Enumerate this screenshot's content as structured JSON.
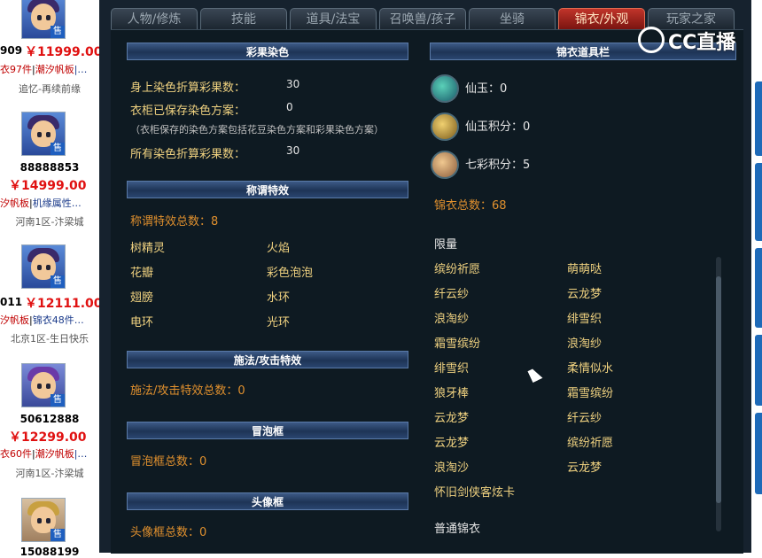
{
  "left_list": [
    {
      "id": "909",
      "price": "￥11999.00",
      "tag1": "衣97件",
      "tag2": "潮汐帆板",
      "tag_more": "…",
      "server": "追忆-再续前缘"
    },
    {
      "id": "88888853",
      "price": "￥14999.00",
      "tag1": "汐帆板",
      "tag2": "机缘属性",
      "tag_more": "…",
      "server": "河南1区-汴梁城"
    },
    {
      "id": "011",
      "price": "￥12111.00",
      "tag1": "汐帆板",
      "tag2": "锦衣48件",
      "tag_more": "…",
      "server": "北京1区-生日快乐"
    },
    {
      "id": "50612888",
      "price": "￥12299.00",
      "tag1": "衣60件",
      "tag2": "潮汐帆板",
      "tag_more": "…",
      "server": "河南1区-汴梁城"
    },
    {
      "id": "15088199",
      "price": "",
      "tag1": "",
      "tag2": "",
      "tag_more": "",
      "server": ""
    }
  ],
  "sell_badge": "售",
  "tabs": [
    "人物/修炼",
    "技能",
    "道具/法宝",
    "召唤兽/孩子",
    "坐骑",
    "锦衣/外观",
    "玩家之家"
  ],
  "active_tab": "锦衣/外观",
  "logo": {
    "text": "CC直播"
  },
  "sections": {
    "dye": {
      "title": "彩果染色",
      "rows": [
        {
          "label": "身上染色折算彩果数：",
          "value": "30"
        },
        {
          "label": "衣柜已保存染色方案：",
          "value": "0"
        }
      ],
      "note": "（衣柜保存的染色方案包括花豆染色方案和彩果染色方案）",
      "total_label": "所有染色折算彩果数：",
      "total_value": "30"
    },
    "title_fx": {
      "title": "称谓特效",
      "count": "称谓特效总数：8",
      "items": [
        "树精灵",
        "火焰",
        "花瓣",
        "彩色泡泡",
        "翅膀",
        "水环",
        "电环",
        "光环"
      ]
    },
    "cast_fx": {
      "title": "施法/攻击特效",
      "count": "施法/攻击特效总数：0"
    },
    "bubble": {
      "title": "冒泡框",
      "count": "冒泡框总数：0"
    },
    "avatar_frame": {
      "title": "头像框",
      "count": "头像框总数：0"
    },
    "jinyi_bar": {
      "title": "锦衣道具栏",
      "props": [
        {
          "label": "仙玉：0",
          "icon": "jade-icon",
          "color": "#2f9a8a"
        },
        {
          "label": "仙玉积分：0",
          "icon": "jade-points-icon",
          "color": "#d4b04a"
        },
        {
          "label": "七彩积分：5",
          "icon": "rainbow-points-icon",
          "color": "#c9a070"
        }
      ],
      "total": "锦衣总数：68",
      "limited_title": "限量",
      "limited_items": [
        "缤纷祈愿",
        "萌萌哒",
        "纤云纱",
        "云龙梦",
        "浪淘纱",
        "绯雪织",
        "霜雪缤纷",
        "浪淘纱",
        "绯雪织",
        "柔情似水",
        "狼牙棒",
        "霜雪缤纷",
        "云龙梦",
        "纤云纱",
        "云龙梦",
        "缤纷祈愿",
        "浪淘沙",
        "云龙梦"
      ],
      "limited_last": "怀旧剑侠客炫卡",
      "normal_title": "普通锦衣"
    }
  }
}
